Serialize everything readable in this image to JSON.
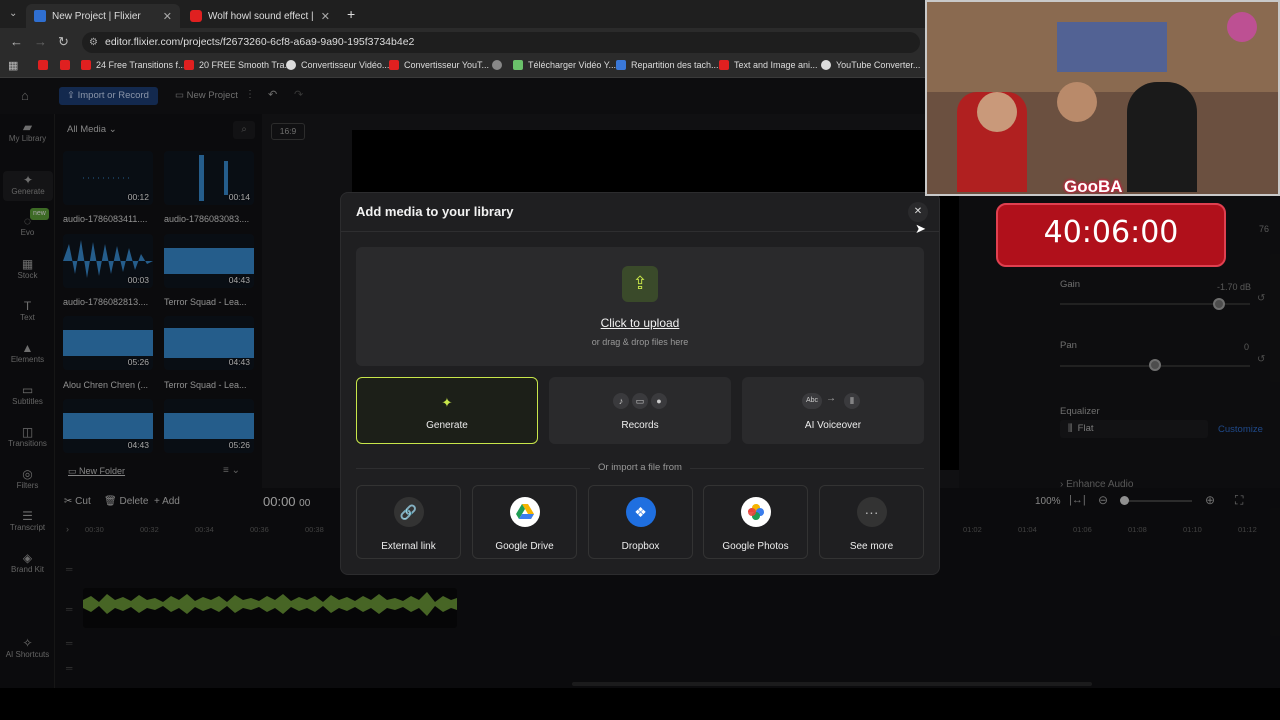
{
  "browser": {
    "tabs": [
      {
        "title": "New Project | Flixier",
        "active": true
      },
      {
        "title": "Wolf howl sound effect | night",
        "active": false
      }
    ],
    "new_tab": "+",
    "url": "editor.flixier.com/projects/f2673260-6cf8-a6a9-9a90-195f3734b4e2",
    "bookmarks": [
      "24 Free Transitions f...",
      "20 FREE Smooth Tra...",
      "Convertisseur Vidéo...",
      "Convertisseur YouT...",
      "Télécharger Vidéo Y...",
      "Repartition des tach...",
      "Text and Image ani...",
      "YouTube Converter..."
    ]
  },
  "appbar": {
    "import_label": "Import or Record",
    "project_name": "New Project",
    "aspect_ratio": "16:9"
  },
  "sidebar": [
    {
      "label": "My Library",
      "icon": "folder-icon"
    },
    {
      "label": "Generate",
      "icon": "sparkle-icon"
    },
    {
      "label": "Evo",
      "icon": "evo-icon",
      "badge": "new"
    },
    {
      "label": "Stock",
      "icon": "grid-icon"
    },
    {
      "label": "Text",
      "icon": "text-icon"
    },
    {
      "label": "Elements",
      "icon": "shapes-icon"
    },
    {
      "label": "Subtitles",
      "icon": "subtitles-icon"
    },
    {
      "label": "Transitions",
      "icon": "transitions-icon"
    },
    {
      "label": "Filters",
      "icon": "filters-icon"
    },
    {
      "label": "Transcript",
      "icon": "transcript-icon"
    },
    {
      "label": "Brand Kit",
      "icon": "brandkit-icon"
    },
    {
      "label": "AI Shortcuts",
      "icon": "ai-icon"
    }
  ],
  "library": {
    "filter": "All Media",
    "items": [
      {
        "name": "audio-1786083411....",
        "duration": "00:12"
      },
      {
        "name": "audio-1786083083....",
        "duration": "00:14"
      },
      {
        "name": "audio-1786082813....",
        "duration": "00:03"
      },
      {
        "name": "Terror Squad - Lea...",
        "duration": "04:43"
      },
      {
        "name": "Alou Chren Chren (...",
        "duration": "05:26"
      },
      {
        "name": "Terror Squad - Lea...",
        "duration": "04:43"
      },
      {
        "name": "",
        "duration": "04:43"
      },
      {
        "name": "",
        "duration": "05:26"
      }
    ],
    "new_folder": "New Folder"
  },
  "toolbar": {
    "cut": "Cut",
    "delete": "Delete",
    "add": "Add",
    "timecode": "00:00",
    "timecode_frames": "00",
    "zoom": "100%"
  },
  "timeline": {
    "ticks_left": [
      "00:30",
      "00:32",
      "00:34",
      "00:36",
      "00:38"
    ],
    "ticks_right": [
      "01:02",
      "01:04",
      "01:06",
      "01:08",
      "01:10",
      "01:12"
    ]
  },
  "audio_panel": {
    "volume_value": "76",
    "gain_label": "Gain",
    "gain_value": "-1.70 dB",
    "pan_label": "Pan",
    "pan_value": "0",
    "equalizer_label": "Equalizer",
    "equalizer_preset": "Flat",
    "customize": "Customize",
    "enhance": "Enhance Audio"
  },
  "modal": {
    "title": "Add media to your library",
    "upload_title": "Click to upload",
    "upload_subtitle": "or drag & drop files here",
    "options": [
      "Generate",
      "Records",
      "AI Voiceover"
    ],
    "voiceover_abc": "Abc",
    "divider": "Or import a file from",
    "sources": [
      "External link",
      "Google Drive",
      "Dropbox",
      "Google Photos",
      "See more"
    ]
  },
  "overlay": {
    "streamer_name": "GooBA",
    "timer": "40:06:00"
  },
  "colors": {
    "accent_blue": "#2f6fd1",
    "generate_green": "#c8e64a",
    "waveform_blue": "#3a8fd6",
    "timer_red": "#b0101b"
  }
}
